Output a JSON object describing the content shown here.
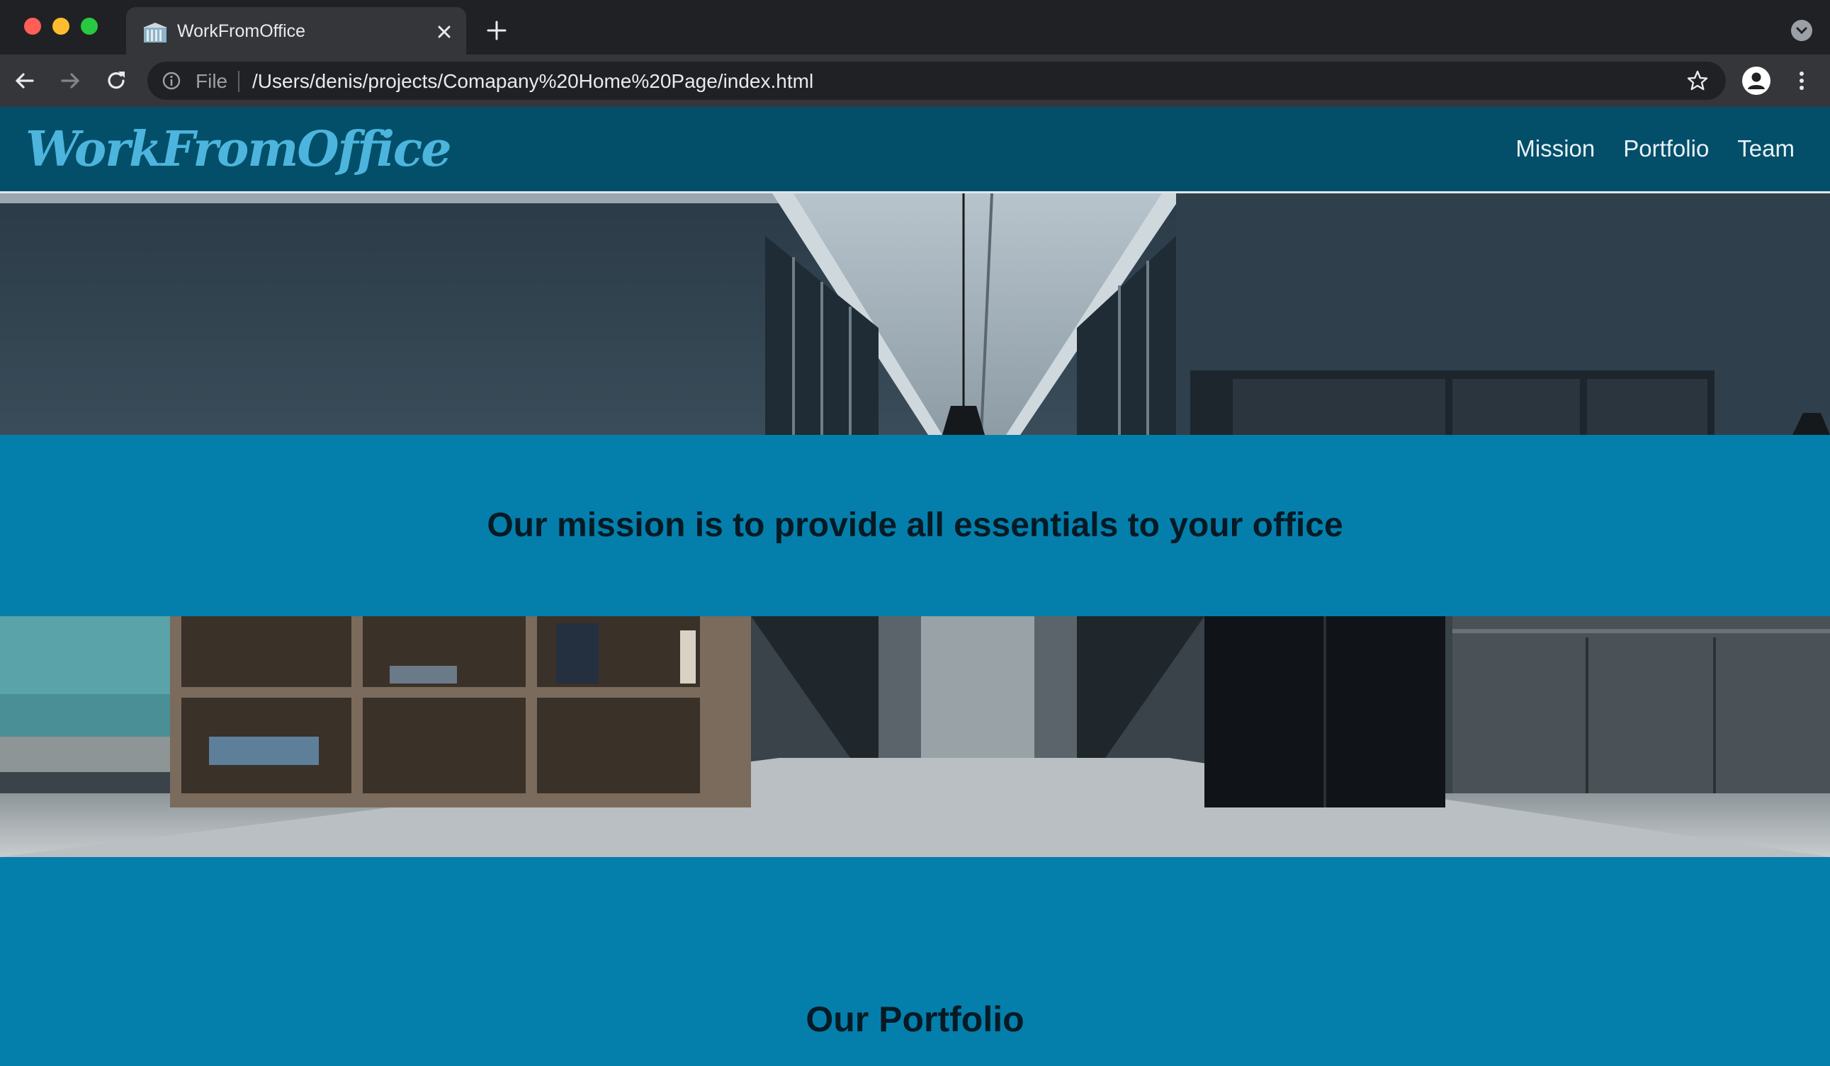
{
  "browser": {
    "tab_title": "WorkFromOffice",
    "file_label": "File",
    "url": "/Users/denis/projects/Comapany%20Home%20Page/index.html"
  },
  "site": {
    "logo": "WorkFromOffice",
    "nav": [
      "Mission",
      "Portfolio",
      "Team"
    ],
    "mission_text": "Our mission is to provide all essentials to your office",
    "portfolio_title": "Our Portfolio"
  },
  "colors": {
    "header_bg": "#034f69",
    "band_bg": "#047fac",
    "logo": "#4db5dd"
  }
}
